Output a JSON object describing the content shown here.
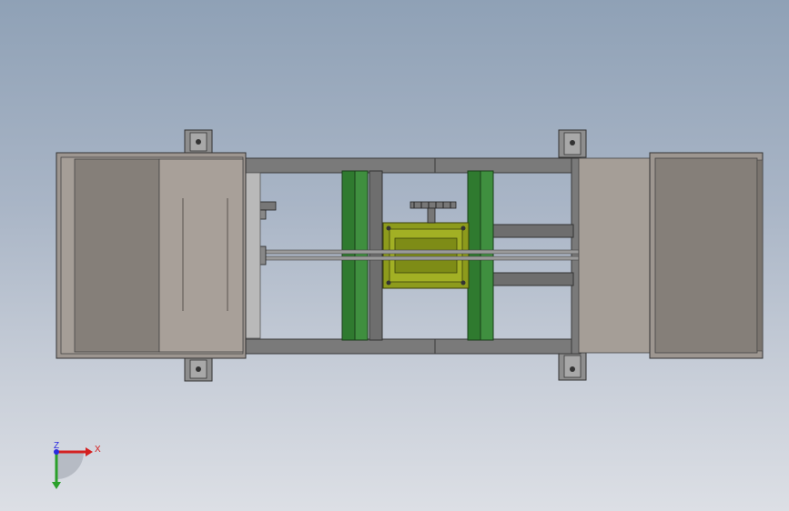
{
  "triad": {
    "x_label": "X",
    "y_label": "Y",
    "z_label": "Z",
    "x_color": "#d42020",
    "y_color": "#2aa02a",
    "z_color": "#2a2ae0"
  },
  "colors": {
    "frame": "#6f6f6f",
    "frame_dark": "#4a4a4a",
    "box_light": "#a59e97",
    "box_dark": "#857f79",
    "green_rail": "#2f7a2f",
    "motor": "#8a9a1a",
    "rod": "#9a9a9a"
  }
}
